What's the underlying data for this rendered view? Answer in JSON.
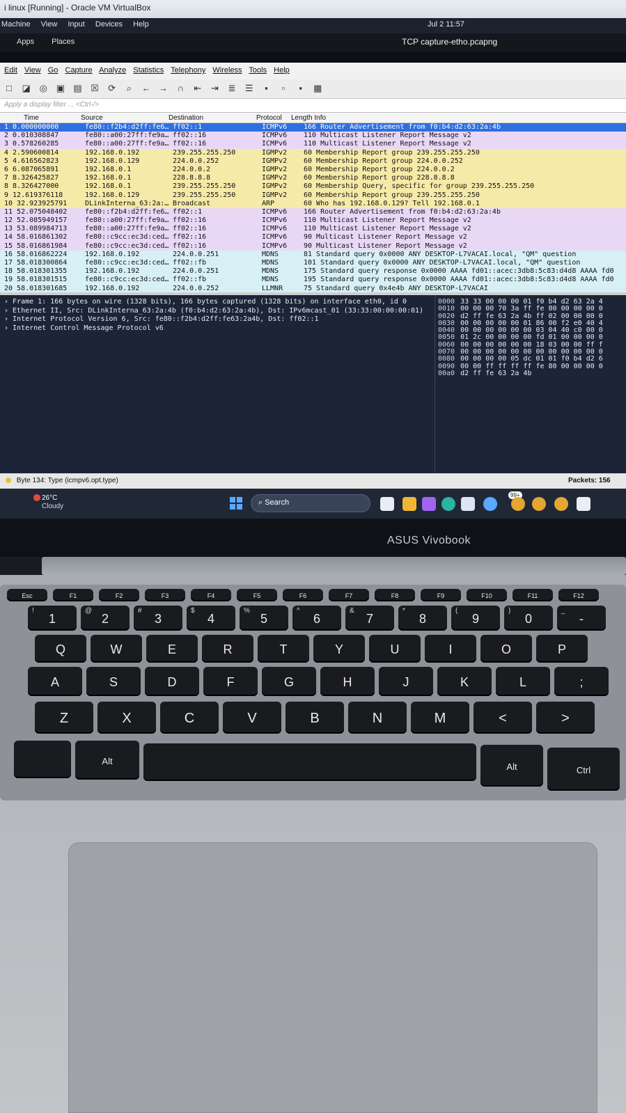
{
  "vbox": {
    "title": "i linux [Running] - Oracle VM VirtualBox",
    "menu": [
      "Machine",
      "View",
      "Input",
      "Devices",
      "Help"
    ]
  },
  "kali": {
    "menu": [
      "Apps",
      "Places"
    ],
    "clock": "Jul 2  11:57",
    "window_title": "TCP capture-etho.pcapng"
  },
  "wireshark": {
    "menu": [
      "Edit",
      "View",
      "Go",
      "Capture",
      "Analyze",
      "Statistics",
      "Telephony",
      "Wireless",
      "Tools",
      "Help"
    ],
    "filter_placeholder": "Apply a display filter ... <Ctrl-/>",
    "columns": [
      "Time",
      "Source",
      "Destination",
      "Protocol",
      "Length Info"
    ],
    "packets": [
      {
        "no": "1 0.000000000",
        "src": "fe80::f2b4:d2ff:fe6…",
        "dst": "ff02::1",
        "proto": "ICMPv6",
        "info": "166 Router Advertisement from f0:b4:d2:63:2a:4b",
        "bg": "#2f6fe0",
        "fg": "#ffffff"
      },
      {
        "no": "2 0.010308847",
        "src": "fe80::a00:27ff:fe9a…",
        "dst": "ff02::16",
        "proto": "ICMPv6",
        "info": "110 Multicast Listener Report Message v2",
        "bg": "#e8d8f6",
        "fg": "#111111"
      },
      {
        "no": "3 0.578260285",
        "src": "fe80::a00:27ff:fe9a…",
        "dst": "ff02::16",
        "proto": "ICMPv6",
        "info": "110 Multicast Listener Report Message v2",
        "bg": "#e8d8f6",
        "fg": "#111111"
      },
      {
        "no": "4 2.590600814",
        "src": "192.168.0.192",
        "dst": "239.255.255.250",
        "proto": "IGMPv2",
        "info": "60 Membership Report group 239.255.255.250",
        "bg": "#f6eaa8",
        "fg": "#111111"
      },
      {
        "no": "5 4.616562823",
        "src": "192.168.0.129",
        "dst": "224.0.0.252",
        "proto": "IGMPv2",
        "info": "60 Membership Report group 224.0.0.252",
        "bg": "#f6eaa8",
        "fg": "#111111"
      },
      {
        "no": "6 6.087065891",
        "src": "192.168.0.1",
        "dst": "224.0.0.2",
        "proto": "IGMPv2",
        "info": "60 Membership Report group 224.0.0.2",
        "bg": "#f6eaa8",
        "fg": "#111111"
      },
      {
        "no": "7 8.326425827",
        "src": "192.168.0.1",
        "dst": "228.8.8.8",
        "proto": "IGMPv2",
        "info": "60 Membership Report group 228.8.8.8",
        "bg": "#f6eaa8",
        "fg": "#111111"
      },
      {
        "no": "8 8.326427000",
        "src": "192.168.0.1",
        "dst": "239.255.255.250",
        "proto": "IGMPv2",
        "info": "60 Membership Query, specific for group 239.255.255.250",
        "bg": "#f6eaa8",
        "fg": "#111111"
      },
      {
        "no": "9 12.619376118",
        "src": "192.168.0.129",
        "dst": "239.255.255.250",
        "proto": "IGMPv2",
        "info": "60 Membership Report group 239.255.255.250",
        "bg": "#f6eaa8",
        "fg": "#111111"
      },
      {
        "no": "10 32.923925791",
        "src": "DLinkInterna_63:2a:…",
        "dst": "Broadcast",
        "proto": "ARP",
        "info": "60 Who has 192.168.0.129? Tell 192.168.0.1",
        "bg": "#f6eaa8",
        "fg": "#111111"
      },
      {
        "no": "11 52.075048402",
        "src": "fe80::f2b4:d2ff:fe6…",
        "dst": "ff02::1",
        "proto": "ICMPv6",
        "info": "166 Router Advertisement from f0:b4:d2:63:2a:4b",
        "bg": "#e8d8f6",
        "fg": "#111111"
      },
      {
        "no": "12 52.085949157",
        "src": "fe80::a00:27ff:fe9a…",
        "dst": "ff02::16",
        "proto": "ICMPv6",
        "info": "110 Multicast Listener Report Message v2",
        "bg": "#e8d8f6",
        "fg": "#111111"
      },
      {
        "no": "13 53.089984713",
        "src": "fe80::a00:27ff:fe9a…",
        "dst": "ff02::16",
        "proto": "ICMPv6",
        "info": "110 Multicast Listener Report Message v2",
        "bg": "#e8d8f6",
        "fg": "#111111"
      },
      {
        "no": "14 58.016861302",
        "src": "fe80::c9cc:ec3d:ced…",
        "dst": "ff02::16",
        "proto": "ICMPv6",
        "info": "90 Multicast Listener Report Message v2",
        "bg": "#e8d8f6",
        "fg": "#111111"
      },
      {
        "no": "15 58.016861984",
        "src": "fe80::c9cc:ec3d:ced…",
        "dst": "ff02::16",
        "proto": "ICMPv6",
        "info": "90 Multicast Listener Report Message v2",
        "bg": "#e8d8f6",
        "fg": "#111111"
      },
      {
        "no": "16 58.016862224",
        "src": "192.168.0.192",
        "dst": "224.0.0.251",
        "proto": "MDNS",
        "info": "81 Standard query 0x0000 ANY DESKTOP-L7VACAI.local, \"QM\" question",
        "bg": "#d6f0f6",
        "fg": "#111111"
      },
      {
        "no": "17 58.018300864",
        "src": "fe80::c9cc:ec3d:ced…",
        "dst": "ff02::fb",
        "proto": "MDNS",
        "info": "101 Standard query 0x0000 ANY DESKTOP-L7VACAI.local, \"QM\" question",
        "bg": "#d6f0f6",
        "fg": "#111111"
      },
      {
        "no": "18 58.018301355",
        "src": "192.168.0.192",
        "dst": "224.0.0.251",
        "proto": "MDNS",
        "info": "175 Standard query response 0x0000 AAAA fd01::acec:3db8:5c83:d4d8 AAAA fd0",
        "bg": "#d6f0f6",
        "fg": "#111111"
      },
      {
        "no": "19 58.018301515",
        "src": "fe80::c9cc:ec3d:ced…",
        "dst": "ff02::fb",
        "proto": "MDNS",
        "info": "195 Standard query response 0x0000 AAAA fd01::acec:3db8:5c83:d4d8 AAAA fd0",
        "bg": "#d6f0f6",
        "fg": "#111111"
      },
      {
        "no": "20 58.018301685",
        "src": "192.168.0.192",
        "dst": "224.0.0.252",
        "proto": "LLMNR",
        "info": "75 Standard query 0x4e4b ANY DESKTOP-L7VACAI",
        "bg": "#d6f0f6",
        "fg": "#111111"
      }
    ],
    "details": [
      "› Frame 1: 166 bytes on wire (1328 bits), 166 bytes captured (1328 bits) on interface eth0, id 0",
      "› Ethernet II, Src: DLinkInterna_63:2a:4b (f0:b4:d2:63:2a:4b), Dst: IPv6mcast_01 (33:33:00:00:00:01)",
      "› Internet Protocol Version 6, Src: fe80::f2b4:d2ff:fe63:2a4b, Dst: ff02::1",
      "› Internet Control Message Protocol v6"
    ],
    "hex": [
      {
        "off": "0000",
        "bytes": "33 33 00 00 00 01 f0 b4  d2 63 2a 4"
      },
      {
        "off": "0010",
        "bytes": "00 00 00 70 3a ff fe 80  00 00 00 0"
      },
      {
        "off": "0020",
        "bytes": "d2 ff fe 63 2a 4b ff 02  00 00 00 0"
      },
      {
        "off": "0030",
        "bytes": "00 00 00 00 00 01 86 00  f2 e0 40 4"
      },
      {
        "off": "0040",
        "bytes": "00 00 00 00 00 00 03 04  40 c0 00 0"
      },
      {
        "off": "0050",
        "bytes": "01 2c 00 00 00 00 fd 01  00 00 00 0"
      },
      {
        "off": "0060",
        "bytes": "00 00 00 00 00 00 18 03  00 00 ff f"
      },
      {
        "off": "0070",
        "bytes": "00 00 00 00 00 00 00 00  00 00 00 0"
      },
      {
        "off": "0080",
        "bytes": "00 00 00 00 05 dc 01 01  f0 b4 d2 6"
      },
      {
        "off": "0090",
        "bytes": "00 00 ff ff ff ff fe 80  00 00 00 0"
      },
      {
        "off": "00a0",
        "bytes": "d2 ff fe 63 2a 4b"
      }
    ],
    "status_left": "Byte 134: Type (icmpv6.opt.type)",
    "status_right": "Packets: 156"
  },
  "taskbar": {
    "temp": "26°C",
    "weather": "Cloudy",
    "search": "Search",
    "badge": "99+"
  },
  "laptop": {
    "brand": "ASUS Vivobook",
    "fn_row": [
      "Esc",
      "F1",
      "F2",
      "F3",
      "F4",
      "F5",
      "F6",
      "F7",
      "F8",
      "F9",
      "F10",
      "F11",
      "F12"
    ],
    "num_row": [
      {
        "main": "1",
        "shift": "!"
      },
      {
        "main": "2",
        "shift": "@"
      },
      {
        "main": "3",
        "shift": "#"
      },
      {
        "main": "4",
        "shift": "$"
      },
      {
        "main": "5",
        "shift": "%"
      },
      {
        "main": "6",
        "shift": "^"
      },
      {
        "main": "7",
        "shift": "&"
      },
      {
        "main": "8",
        "shift": "*"
      },
      {
        "main": "9",
        "shift": "("
      },
      {
        "main": "0",
        "shift": ")"
      },
      {
        "main": "-",
        "shift": "_"
      }
    ],
    "row_q": [
      "Q",
      "W",
      "E",
      "R",
      "T",
      "Y",
      "U",
      "I",
      "O",
      "P"
    ],
    "row_a": [
      "A",
      "S",
      "D",
      "F",
      "G",
      "H",
      "J",
      "K",
      "L",
      ";"
    ],
    "row_z": [
      "Z",
      "X",
      "C",
      "V",
      "B",
      "N",
      "M",
      "<",
      ">"
    ],
    "alt_left": "Alt",
    "alt_right": "Alt",
    "ctrl_right": "Ctrl"
  }
}
